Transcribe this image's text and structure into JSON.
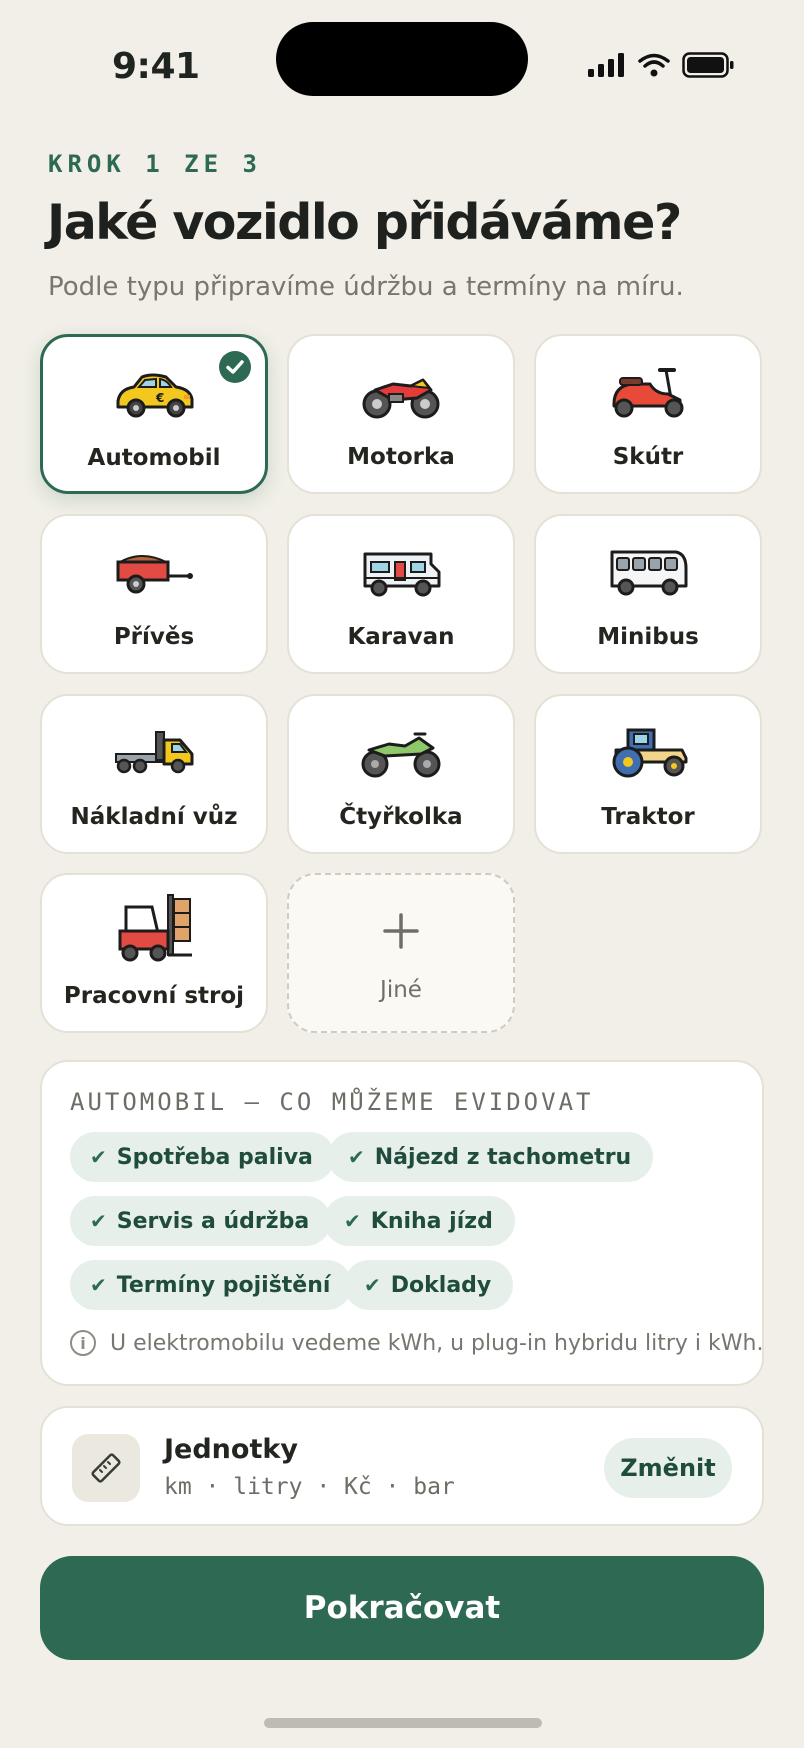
{
  "status_bar": {
    "time": "9:41"
  },
  "header": {
    "step": "KROK 1 ZE 3",
    "title": "Jaké vozidlo přidáváme?",
    "subtitle": "Podle typu připravíme údržbu a termíny na míru."
  },
  "vehicle_types": [
    {
      "label": "Automobil",
      "icon": "car-icon",
      "selected": true
    },
    {
      "label": "Motorka",
      "icon": "motorcycle-icon",
      "selected": false
    },
    {
      "label": "Skútr",
      "icon": "scooter-icon",
      "selected": false
    },
    {
      "label": "Přívěs",
      "icon": "trailer-icon",
      "selected": false
    },
    {
      "label": "Karavan",
      "icon": "caravan-icon",
      "selected": false
    },
    {
      "label": "Minibus",
      "icon": "minibus-icon",
      "selected": false
    },
    {
      "label": "Nákladní vůz",
      "icon": "truck-icon",
      "selected": false
    },
    {
      "label": "Čtyřkolka",
      "icon": "atv-icon",
      "selected": false
    },
    {
      "label": "Traktor",
      "icon": "tractor-icon",
      "selected": false
    },
    {
      "label": "Pracovní stroj",
      "icon": "forklift-icon",
      "selected": false
    }
  ],
  "other_option": {
    "label": "Jiné",
    "icon": "plus-icon"
  },
  "tracking_panel": {
    "title": "AUTOMOBIL — CO MŮŽEME EVIDOVAT",
    "chips": [
      "Spotřeba paliva",
      "Nájezd z tachometru",
      "Servis a údržba",
      "Kniha jízd",
      "Termíny pojištění",
      "Doklady"
    ],
    "note": "U elektromobilu vedeme kWh, u plug-in hybridu litry i kWh."
  },
  "units": {
    "title": "Jednotky",
    "value": "km · litry · Kč · bar",
    "change_label": "Změnit",
    "icon": "ruler-icon"
  },
  "continue_label": "Pokračovat",
  "colors": {
    "accent": "#2e6a53",
    "background": "#f1efe7",
    "chip_bg": "#e6efe9"
  }
}
